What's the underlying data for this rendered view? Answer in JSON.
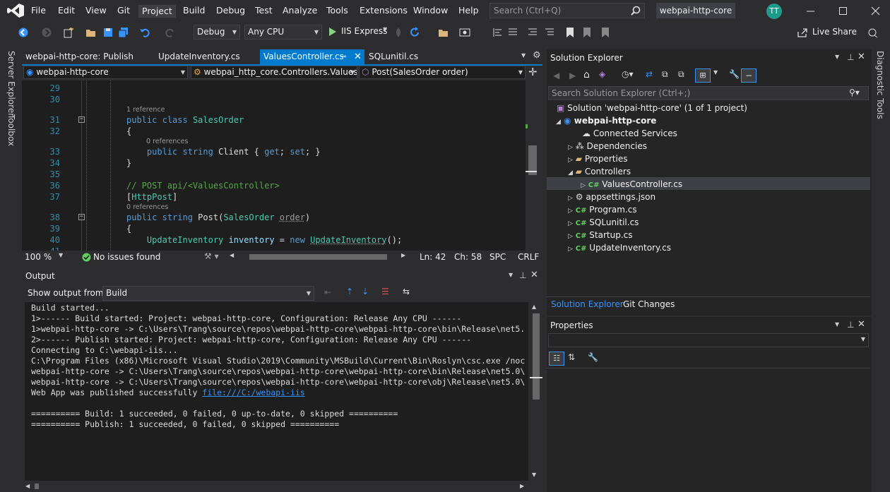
{
  "menu": {
    "items": [
      "File",
      "Edit",
      "View",
      "Git",
      "Project",
      "Build",
      "Debug",
      "Test",
      "Analyze",
      "Tools",
      "Extensions",
      "Window",
      "Help"
    ],
    "active": "Project",
    "search_placeholder": "Search (Ctrl+Q)",
    "solution_name": "webpai-http-core",
    "avatar_initials": "TT"
  },
  "toolbar": {
    "config": "Debug",
    "platform": "Any CPU",
    "run_target": "IIS Express",
    "live_share": "Live Share"
  },
  "left_strip": {
    "server_explorer": "Server Explorer",
    "toolbox": "Toolbox"
  },
  "right_strip": {
    "diagnostic_tools": "Diagnostic Tools"
  },
  "editor": {
    "tabs": [
      {
        "label": "webpai-http-core: Publish",
        "active": false
      },
      {
        "label": "UpdateInventory.cs",
        "active": false
      },
      {
        "label": "ValuesController.cs",
        "active": true
      },
      {
        "label": "SQLunitil.cs",
        "active": false
      }
    ],
    "nav": {
      "project": "webpai-http-core",
      "class": "webpai_http_core.Controllers.ValuesC",
      "member": "Post(SalesOrder order)"
    },
    "lines": [
      {
        "n": "29",
        "code": ""
      },
      {
        "n": "30",
        "code": ""
      },
      {
        "n": "31",
        "ref": "1 reference",
        "code": "public class SalesOrder"
      },
      {
        "n": "32",
        "code": "{"
      },
      {
        "n": "33",
        "ref": "0 references",
        "code": "    public string Client { get; set; }"
      },
      {
        "n": "34",
        "code": "}"
      },
      {
        "n": "35",
        "code": ""
      },
      {
        "n": "36",
        "code": "// POST api/<ValuesController>"
      },
      {
        "n": "37",
        "code": "[HttpPost]"
      },
      {
        "n": "38",
        "ref": "0 references",
        "code": "public string Post(SalesOrder order)"
      },
      {
        "n": "39",
        "code": "{"
      },
      {
        "n": "40",
        "code": "    UpdateInventory inventory = new UpdateInventory();"
      },
      {
        "n": "41",
        "code": ""
      }
    ],
    "status": {
      "zoom": "100 %",
      "issues": "No issues found",
      "line": "Ln: 42",
      "col": "Ch: 58",
      "spc": "SPC",
      "eol": "CRLF"
    }
  },
  "output": {
    "title": "Output",
    "show_from_label": "Show output from:",
    "show_from_value": "Build",
    "lines": [
      "Build started...",
      "1>------ Build started: Project: webpai-http-core, Configuration: Release Any CPU ------",
      "1>webpai-http-core -> C:\\Users\\Trang\\source\\repos\\webpai-http-core\\webpai-http-core\\bin\\Release\\net5.",
      "2>------ Publish started: Project: webpai-http-core, Configuration: Release Any CPU ------",
      "Connecting to C:\\webapi-iis...",
      "C:\\Program Files (x86)\\Microsoft Visual Studio\\2019\\Community\\MSBuild\\Current\\Bin\\Roslyn\\csc.exe /noc",
      "webpai-http-core -> C:\\Users\\Trang\\source\\repos\\webpai-http-core\\webpai-http-core\\bin\\Release\\net5.0\\",
      "webpai-http-core -> C:\\Users\\Trang\\source\\repos\\webpai-http-core\\webpai-http-core\\obj\\Release\\net5.0\\",
      "Web App was published successfully ",
      "",
      "========== Build: 1 succeeded, 0 failed, 0 up-to-date, 0 skipped ==========",
      "========== Publish: 1 succeeded, 0 failed, 0 skipped =========="
    ],
    "publish_link": "file:///C:/webapi-iis"
  },
  "solution_explorer": {
    "title": "Solution Explorer",
    "search_placeholder": "Search Solution Explorer (Ctrl+;)",
    "solution": "Solution 'webpai-http-core' (1 of 1 project)",
    "project": "webpai-http-core",
    "items": [
      {
        "label": "Connected Services"
      },
      {
        "label": "Dependencies"
      },
      {
        "label": "Properties"
      },
      {
        "label": "Controllers"
      },
      {
        "label": "ValuesController.cs"
      },
      {
        "label": "appsettings.json"
      },
      {
        "label": "Program.cs"
      },
      {
        "label": "SQLunitil.cs"
      },
      {
        "label": "Startup.cs"
      },
      {
        "label": "UpdateInventory.cs"
      }
    ],
    "bottom_tabs": [
      "Solution Explorer",
      "Git Changes"
    ]
  },
  "properties": {
    "title": "Properties"
  },
  "colors": {
    "accent": "#007acc",
    "background": "#2d2d30",
    "editor_bg": "#1e1e1e"
  }
}
